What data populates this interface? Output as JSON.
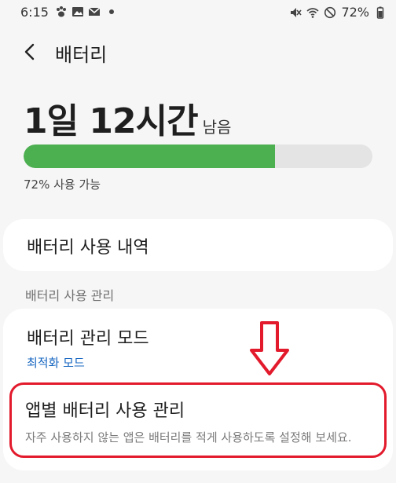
{
  "status_bar": {
    "time": "6:15",
    "battery_percent": "72%",
    "left_icons": [
      "paw-icon",
      "image-icon",
      "mail-icon",
      "dot-icon"
    ],
    "right_icons": [
      "mute-icon",
      "wifi-icon",
      "do-not-disturb-icon",
      "battery-icon"
    ]
  },
  "header": {
    "title": "배터리",
    "back_icon": "chevron-left-icon"
  },
  "remaining": {
    "time": "1일 12시간",
    "suffix": "남음"
  },
  "battery": {
    "level": 0.72,
    "available_text": "72% 사용 가능",
    "fill_color": "#4caf50"
  },
  "usage_card": {
    "title": "배터리 사용 내역"
  },
  "manage_section": {
    "label": "배터리 사용 관리",
    "items": [
      {
        "title": "배터리 관리 모드",
        "subtitle": "최적화 모드"
      },
      {
        "title": "앱별 배터리 사용 관리",
        "description": "자주 사용하지 않는 앱은 배터리를 적게 사용하도록 설정해 보세요."
      }
    ]
  },
  "annotation": {
    "color": "#e21a2c"
  }
}
